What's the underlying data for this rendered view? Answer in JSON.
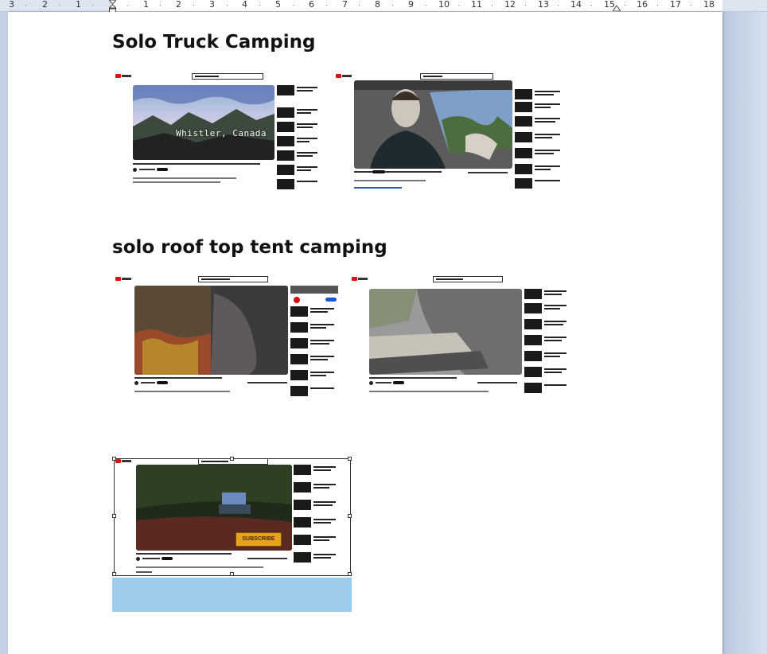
{
  "ruler": {
    "numbers": [
      "3",
      "2",
      "1",
      "1",
      "2",
      "3",
      "4",
      "5",
      "6",
      "7",
      "8",
      "9",
      "10",
      "11",
      "12",
      "13",
      "14",
      "15",
      "16",
      "17",
      "18"
    ]
  },
  "document": {
    "heading1": "Solo Truck Camping",
    "heading2": "solo roof top tent camping",
    "overlay_text": "Whistler, Canada",
    "subscribe_label": "SUBSCRIBE"
  },
  "colors": {
    "page": "#ffffff",
    "background": "#cfdbeb",
    "selection_fill": "#9dcbec",
    "youtube_red": "#e01010",
    "subscribe_button": "#e6a21a"
  },
  "images": [
    {
      "name": "solo-truck-camping-video-1",
      "caption": "YouTube video screenshot - mountain landscape"
    },
    {
      "name": "solo-truck-camping-video-2",
      "caption": "YouTube video screenshot - man driving truck"
    },
    {
      "name": "roof-top-tent-video-1",
      "caption": "YouTube video screenshot - forest tent"
    },
    {
      "name": "roof-top-tent-video-2",
      "caption": "YouTube video screenshot - truck bed camping"
    },
    {
      "name": "roof-top-tent-video-3",
      "caption": "YouTube video screenshot - forest camp (selected)"
    }
  ]
}
